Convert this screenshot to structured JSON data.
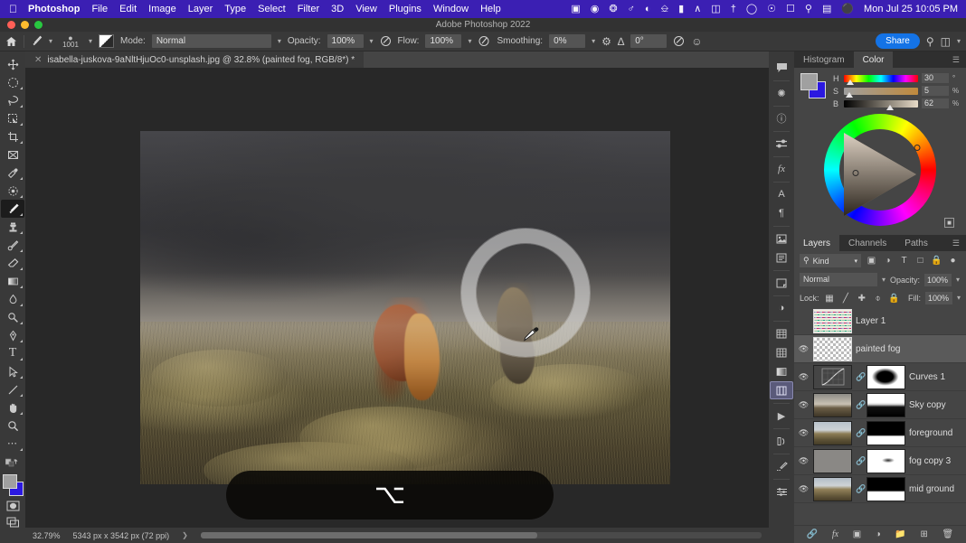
{
  "macos": {
    "apple_icon": "apple-logo",
    "menus": [
      "Photoshop",
      "File",
      "Edit",
      "Image",
      "Layer",
      "Type",
      "Select",
      "Filter",
      "3D",
      "View",
      "Plugins",
      "Window",
      "Help"
    ],
    "status_icons": [
      "screen-record-icon",
      "webcam-icon",
      "dropbox-icon",
      "globe-icon",
      "cloud-icon",
      "nvidia-icon",
      "bookmark-icon",
      "arc-icon",
      "grid-icon",
      "bluetooth-off-icon",
      "wifi-icon",
      "user-icon",
      "display-icon",
      "spotlight-search-icon",
      "control-center-icon",
      "siri-icon"
    ],
    "clock": "Mon Jul 25  10:05 PM",
    "menubar_color": "#3b1fb3"
  },
  "window": {
    "title": "Adobe Photoshop 2022",
    "traffic_lights": [
      "close-button",
      "minimize-button",
      "zoom-button"
    ]
  },
  "options_bar": {
    "home_icon": "home-icon",
    "brush_icon": "brush-tool-icon",
    "brush_size": "1001",
    "brush_preset_icon": "brush-preset-picker-icon",
    "mode_label": "Mode:",
    "mode_value": "Normal",
    "opacity_label": "Opacity:",
    "opacity_value": "100%",
    "pressure_opacity_icon": "pressure-for-opacity-icon",
    "flow_label": "Flow:",
    "flow_value": "100%",
    "airbrush_icon": "airbrush-icon",
    "smoothing_label": "Smoothing:",
    "smoothing_value": "0%",
    "smoothing_gear_icon": "smoothing-options-gear-icon",
    "angle_icon": "brush-angle-icon",
    "angle_value": "0°",
    "pressure_size_icon": "pressure-for-size-icon",
    "symmetry_icon": "symmetry-butterfly-icon",
    "share_label": "Share",
    "search_icon": "search-icon",
    "workspace_icon": "workspace-switcher-icon"
  },
  "document": {
    "tab_close_icon": "close-tab-icon",
    "tab_title": "isabella-juskova-9aNltHjuOc0-unsplash.jpg @ 32.8% (painted fog, RGB/8*) *"
  },
  "toolbar": {
    "tools": [
      {
        "name": "move-tool",
        "glyph": "✥"
      },
      {
        "name": "elliptical-marquee-tool",
        "glyph": "◯"
      },
      {
        "name": "lasso-tool",
        "glyph": "lasso"
      },
      {
        "name": "object-selection-tool",
        "glyph": "quickselect"
      },
      {
        "name": "crop-tool",
        "glyph": "crop"
      },
      {
        "name": "frame-tool",
        "glyph": "⊠"
      },
      {
        "name": "eyedropper-tool",
        "glyph": "eyedropper"
      },
      {
        "name": "spot-healing-brush-tool",
        "glyph": "healing"
      },
      {
        "name": "brush-tool",
        "glyph": "brush",
        "active": true
      },
      {
        "name": "clone-stamp-tool",
        "glyph": "stamp"
      },
      {
        "name": "history-brush-tool",
        "glyph": "history"
      },
      {
        "name": "eraser-tool",
        "glyph": "eraser"
      },
      {
        "name": "gradient-tool",
        "glyph": "gradient"
      },
      {
        "name": "blur-tool",
        "glyph": "blur"
      },
      {
        "name": "dodge-tool",
        "glyph": "dodge"
      },
      {
        "name": "pen-tool",
        "glyph": "pen"
      },
      {
        "name": "type-tool",
        "glyph": "T"
      },
      {
        "name": "path-selection-tool",
        "glyph": "arrow"
      },
      {
        "name": "line-shape-tool",
        "glyph": "line"
      },
      {
        "name": "hand-tool",
        "glyph": "hand"
      },
      {
        "name": "zoom-tool",
        "glyph": "zoom"
      },
      {
        "name": "edit-toolbar-more",
        "glyph": "…"
      },
      {
        "name": "default-colors-icon",
        "glyph": "defaults"
      }
    ],
    "foreground_color": "#a0a0a0",
    "background_color": "#2b18e0",
    "quick_mask_icon": "quick-mask-icon",
    "screen_mode_icon": "screen-mode-icon"
  },
  "canvas": {
    "image_description": "two Icelandic horses in misty grassland under a dark stormy sky",
    "brush_cursor": "brush-ring-cursor",
    "cursor_icon": "eyedropper-cursor",
    "hud_key": "⌥"
  },
  "status_bar": {
    "zoom": "32.79%",
    "dimensions": "5343 px x 3542 px (72 ppi)",
    "expand_icon": "status-expand-arrow"
  },
  "rail": {
    "icons": [
      {
        "name": "comments-panel-icon",
        "glyph": "💬"
      },
      {
        "name": "brush-settings-panel-icon",
        "glyph": "✺"
      },
      {
        "name": "info-panel-icon",
        "glyph": "ⓘ"
      },
      {
        "name": "adjustments-panel-icon",
        "glyph": "sliders"
      },
      {
        "name": "layer-styles-panel-icon",
        "glyph": "fx"
      },
      {
        "name": "character-panel-icon",
        "glyph": "A"
      },
      {
        "name": "paragraph-panel-icon",
        "glyph": "¶"
      },
      {
        "name": "libraries-panel-icon",
        "glyph": "lib"
      },
      {
        "name": "notes-panel-icon",
        "glyph": "note"
      },
      {
        "name": "properties-panel-icon",
        "glyph": "prop"
      },
      {
        "name": "adjustments-circle-icon",
        "glyph": "◐"
      },
      {
        "name": "swatches-panel-icon",
        "glyph": "swatch"
      },
      {
        "name": "patterns-panel-icon",
        "glyph": "grid"
      },
      {
        "name": "gradients-panel-icon",
        "glyph": "grad"
      },
      {
        "name": "layers-panel-icon",
        "glyph": "layers",
        "active": true
      },
      {
        "name": "actions-panel-icon",
        "glyph": "▶"
      },
      {
        "name": "history-panel-icon",
        "glyph": "history"
      },
      {
        "name": "tool-presets-panel-icon",
        "glyph": "presets"
      },
      {
        "name": "channel-mixer-panel-icon",
        "glyph": "mixer"
      }
    ]
  },
  "color_panel": {
    "tabs": [
      {
        "label": "Histogram",
        "selected": false
      },
      {
        "label": "Color",
        "selected": true
      }
    ],
    "menu_icon": "panel-menu-icon",
    "foreground_color": "#a0a0a0",
    "background_color": "#2b18e0",
    "sliders": [
      {
        "label": "H",
        "value": "30",
        "unit": "°",
        "percent": 8
      },
      {
        "label": "S",
        "value": "5",
        "unit": "%",
        "percent": 7
      },
      {
        "label": "B",
        "value": "62",
        "unit": "%",
        "percent": 62
      }
    ],
    "wheel_icon": "color-wheel",
    "add_swatch_icon": "add-to-swatches-icon"
  },
  "layers_panel": {
    "tabs": [
      {
        "label": "Layers",
        "selected": true
      },
      {
        "label": "Channels",
        "selected": false
      },
      {
        "label": "Paths",
        "selected": false
      }
    ],
    "menu_icon": "panel-menu-icon",
    "filter_label": "Kind",
    "filter_search_icon": "search-icon",
    "filter_icons": [
      "filter-pixel-icon",
      "filter-adjustment-icon",
      "filter-type-icon",
      "filter-shape-icon",
      "filter-smart-object-icon",
      "filter-toggle-icon"
    ],
    "blend_mode": "Normal",
    "opacity_label": "Opacity:",
    "opacity_value": "100%",
    "lock_label": "Lock:",
    "lock_icons": [
      "lock-transparent-pixels-icon",
      "lock-image-pixels-icon",
      "lock-position-icon",
      "lock-artboard-icon",
      "lock-all-icon"
    ],
    "fill_label": "Fill:",
    "fill_value": "100%",
    "layers": [
      {
        "name": "Layer 1",
        "visible": false,
        "selected": false,
        "kind": "pixel-sketch",
        "has_mask": false
      },
      {
        "name": "painted fog",
        "visible": true,
        "selected": true,
        "kind": "transparent",
        "has_mask": false
      },
      {
        "name": "Curves 1",
        "visible": true,
        "selected": false,
        "kind": "adjustment-curves",
        "has_mask": true
      },
      {
        "name": "Sky copy",
        "visible": true,
        "selected": false,
        "kind": "photo-sky",
        "has_mask": true
      },
      {
        "name": "foreground",
        "visible": true,
        "selected": false,
        "kind": "photo-field",
        "has_mask": true
      },
      {
        "name": "fog copy 3",
        "visible": true,
        "selected": false,
        "kind": "solid-gray",
        "has_mask": true
      },
      {
        "name": "mid ground",
        "visible": true,
        "selected": false,
        "kind": "photo-field",
        "has_mask": true
      }
    ],
    "footer_icons": [
      "link-layers-icon",
      "add-layer-style-fx-icon",
      "add-layer-mask-icon",
      "new-adjustment-layer-icon",
      "new-group-icon",
      "new-layer-icon",
      "delete-layer-icon"
    ]
  }
}
